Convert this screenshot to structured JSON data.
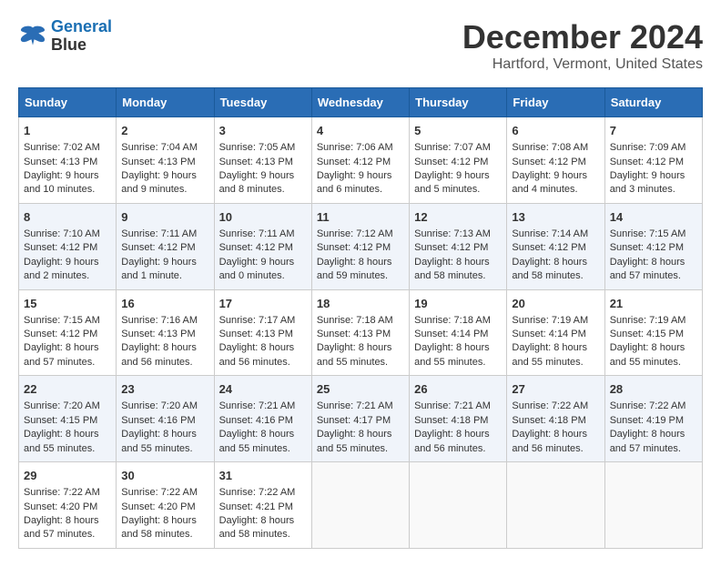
{
  "logo": {
    "line1": "General",
    "line2": "Blue"
  },
  "title": "December 2024",
  "subtitle": "Hartford, Vermont, United States",
  "headers": [
    "Sunday",
    "Monday",
    "Tuesday",
    "Wednesday",
    "Thursday",
    "Friday",
    "Saturday"
  ],
  "weeks": [
    [
      {
        "day": "1",
        "lines": [
          "Sunrise: 7:02 AM",
          "Sunset: 4:13 PM",
          "Daylight: 9 hours",
          "and 10 minutes."
        ]
      },
      {
        "day": "2",
        "lines": [
          "Sunrise: 7:04 AM",
          "Sunset: 4:13 PM",
          "Daylight: 9 hours",
          "and 9 minutes."
        ]
      },
      {
        "day": "3",
        "lines": [
          "Sunrise: 7:05 AM",
          "Sunset: 4:13 PM",
          "Daylight: 9 hours",
          "and 8 minutes."
        ]
      },
      {
        "day": "4",
        "lines": [
          "Sunrise: 7:06 AM",
          "Sunset: 4:12 PM",
          "Daylight: 9 hours",
          "and 6 minutes."
        ]
      },
      {
        "day": "5",
        "lines": [
          "Sunrise: 7:07 AM",
          "Sunset: 4:12 PM",
          "Daylight: 9 hours",
          "and 5 minutes."
        ]
      },
      {
        "day": "6",
        "lines": [
          "Sunrise: 7:08 AM",
          "Sunset: 4:12 PM",
          "Daylight: 9 hours",
          "and 4 minutes."
        ]
      },
      {
        "day": "7",
        "lines": [
          "Sunrise: 7:09 AM",
          "Sunset: 4:12 PM",
          "Daylight: 9 hours",
          "and 3 minutes."
        ]
      }
    ],
    [
      {
        "day": "8",
        "lines": [
          "Sunrise: 7:10 AM",
          "Sunset: 4:12 PM",
          "Daylight: 9 hours",
          "and 2 minutes."
        ]
      },
      {
        "day": "9",
        "lines": [
          "Sunrise: 7:11 AM",
          "Sunset: 4:12 PM",
          "Daylight: 9 hours",
          "and 1 minute."
        ]
      },
      {
        "day": "10",
        "lines": [
          "Sunrise: 7:11 AM",
          "Sunset: 4:12 PM",
          "Daylight: 9 hours",
          "and 0 minutes."
        ]
      },
      {
        "day": "11",
        "lines": [
          "Sunrise: 7:12 AM",
          "Sunset: 4:12 PM",
          "Daylight: 8 hours",
          "and 59 minutes."
        ]
      },
      {
        "day": "12",
        "lines": [
          "Sunrise: 7:13 AM",
          "Sunset: 4:12 PM",
          "Daylight: 8 hours",
          "and 58 minutes."
        ]
      },
      {
        "day": "13",
        "lines": [
          "Sunrise: 7:14 AM",
          "Sunset: 4:12 PM",
          "Daylight: 8 hours",
          "and 58 minutes."
        ]
      },
      {
        "day": "14",
        "lines": [
          "Sunrise: 7:15 AM",
          "Sunset: 4:12 PM",
          "Daylight: 8 hours",
          "and 57 minutes."
        ]
      }
    ],
    [
      {
        "day": "15",
        "lines": [
          "Sunrise: 7:15 AM",
          "Sunset: 4:12 PM",
          "Daylight: 8 hours",
          "and 57 minutes."
        ]
      },
      {
        "day": "16",
        "lines": [
          "Sunrise: 7:16 AM",
          "Sunset: 4:13 PM",
          "Daylight: 8 hours",
          "and 56 minutes."
        ]
      },
      {
        "day": "17",
        "lines": [
          "Sunrise: 7:17 AM",
          "Sunset: 4:13 PM",
          "Daylight: 8 hours",
          "and 56 minutes."
        ]
      },
      {
        "day": "18",
        "lines": [
          "Sunrise: 7:18 AM",
          "Sunset: 4:13 PM",
          "Daylight: 8 hours",
          "and 55 minutes."
        ]
      },
      {
        "day": "19",
        "lines": [
          "Sunrise: 7:18 AM",
          "Sunset: 4:14 PM",
          "Daylight: 8 hours",
          "and 55 minutes."
        ]
      },
      {
        "day": "20",
        "lines": [
          "Sunrise: 7:19 AM",
          "Sunset: 4:14 PM",
          "Daylight: 8 hours",
          "and 55 minutes."
        ]
      },
      {
        "day": "21",
        "lines": [
          "Sunrise: 7:19 AM",
          "Sunset: 4:15 PM",
          "Daylight: 8 hours",
          "and 55 minutes."
        ]
      }
    ],
    [
      {
        "day": "22",
        "lines": [
          "Sunrise: 7:20 AM",
          "Sunset: 4:15 PM",
          "Daylight: 8 hours",
          "and 55 minutes."
        ]
      },
      {
        "day": "23",
        "lines": [
          "Sunrise: 7:20 AM",
          "Sunset: 4:16 PM",
          "Daylight: 8 hours",
          "and 55 minutes."
        ]
      },
      {
        "day": "24",
        "lines": [
          "Sunrise: 7:21 AM",
          "Sunset: 4:16 PM",
          "Daylight: 8 hours",
          "and 55 minutes."
        ]
      },
      {
        "day": "25",
        "lines": [
          "Sunrise: 7:21 AM",
          "Sunset: 4:17 PM",
          "Daylight: 8 hours",
          "and 55 minutes."
        ]
      },
      {
        "day": "26",
        "lines": [
          "Sunrise: 7:21 AM",
          "Sunset: 4:18 PM",
          "Daylight: 8 hours",
          "and 56 minutes."
        ]
      },
      {
        "day": "27",
        "lines": [
          "Sunrise: 7:22 AM",
          "Sunset: 4:18 PM",
          "Daylight: 8 hours",
          "and 56 minutes."
        ]
      },
      {
        "day": "28",
        "lines": [
          "Sunrise: 7:22 AM",
          "Sunset: 4:19 PM",
          "Daylight: 8 hours",
          "and 57 minutes."
        ]
      }
    ],
    [
      {
        "day": "29",
        "lines": [
          "Sunrise: 7:22 AM",
          "Sunset: 4:20 PM",
          "Daylight: 8 hours",
          "and 57 minutes."
        ]
      },
      {
        "day": "30",
        "lines": [
          "Sunrise: 7:22 AM",
          "Sunset: 4:20 PM",
          "Daylight: 8 hours",
          "and 58 minutes."
        ]
      },
      {
        "day": "31",
        "lines": [
          "Sunrise: 7:22 AM",
          "Sunset: 4:21 PM",
          "Daylight: 8 hours",
          "and 58 minutes."
        ]
      },
      null,
      null,
      null,
      null
    ]
  ]
}
